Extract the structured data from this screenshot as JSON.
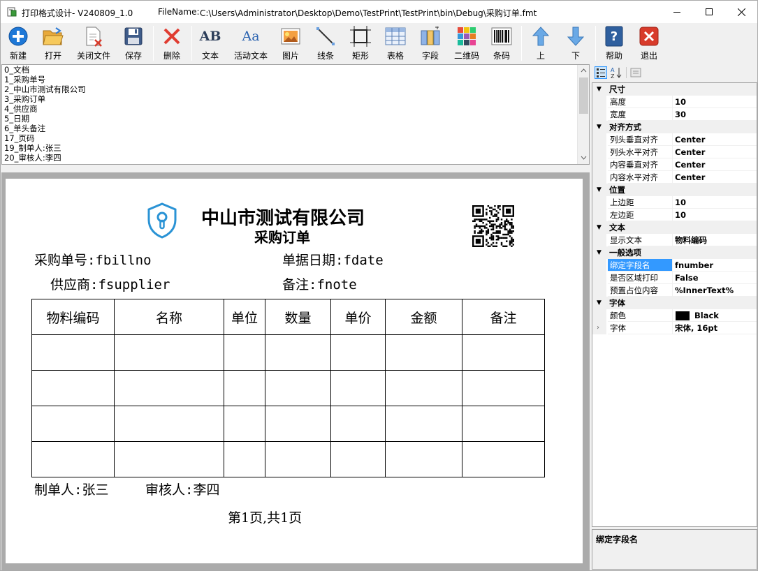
{
  "window": {
    "title": "打印格式设计- V240809_1.0",
    "file_label": "FileName:",
    "file_path": "C:\\Users\\Administrator\\Desktop\\Demo\\TestPrint\\TestPrint\\bin\\Debug\\采购订单.fmt"
  },
  "toolbar": {
    "new": "新建",
    "open": "打开",
    "close_file": "关闭文件",
    "save": "保存",
    "delete": "删除",
    "text": "文本",
    "active_text": "活动文本",
    "image": "图片",
    "line": "线条",
    "rect": "矩形",
    "table": "表格",
    "field": "字段",
    "qrcode": "二维码",
    "barcode": "条码",
    "up": "上",
    "down": "下",
    "help": "帮助",
    "exit": "退出",
    "icon_text": "AB",
    "icon_active_text": "Aa"
  },
  "object_list": {
    "items": [
      "0_文档",
      "1_采购单号",
      "2_中山市测试有限公司",
      "3_采购订单",
      "4_供应商",
      "5_日期",
      "6_单头备注",
      "17_页码",
      "19_制单人:张三",
      "20_审核人:李四"
    ]
  },
  "canvas": {
    "company": "中山市测试有限公司",
    "doc_title": "采购订单",
    "bill_no": "采购单号:fbillno",
    "bill_date": "单据日期:fdate",
    "supplier": "供应商:fsupplier",
    "note": "备注:fnote",
    "columns": [
      "物料编码",
      "名称",
      "单位",
      "数量",
      "单价",
      "金额",
      "备注"
    ],
    "maker": "制单人:张三",
    "reviewer": "审核人:李四",
    "page_info": "第1页,共1页"
  },
  "properties": {
    "categories": {
      "size": "尺寸",
      "alignment": "对齐方式",
      "position": "位置",
      "text": "文本",
      "general": "一般选项",
      "font": "字体"
    },
    "rows": {
      "height": {
        "name": "高度",
        "value": "10"
      },
      "width": {
        "name": "宽度",
        "value": "30"
      },
      "header_valign": {
        "name": "列头垂直对齐",
        "value": "Center"
      },
      "header_halign": {
        "name": "列头水平对齐",
        "value": "Center"
      },
      "content_valign": {
        "name": "内容垂直对齐",
        "value": "Center"
      },
      "content_halign": {
        "name": "内容水平对齐",
        "value": "Center"
      },
      "top_margin": {
        "name": "上边距",
        "value": "10"
      },
      "left_margin": {
        "name": "左边距",
        "value": "10"
      },
      "display_text": {
        "name": "显示文本",
        "value": "物料编码"
      },
      "bind_field": {
        "name": "绑定字段名",
        "value": "fnumber"
      },
      "area_print": {
        "name": "是否区域打印",
        "value": "False"
      },
      "placeholder": {
        "name": "预置占位内容",
        "value": "%InnerText%"
      },
      "color": {
        "name": "颜色",
        "value": "Black"
      },
      "font": {
        "name": "字体",
        "value": "宋体, 16pt"
      }
    },
    "description": "绑定字段名"
  },
  "colors": {
    "accent": "#3399ff",
    "logo": "#2a93d5",
    "new_icon": "#1e78d7",
    "delete_icon": "#e03c31",
    "exit_icon": "#d83b2b"
  }
}
